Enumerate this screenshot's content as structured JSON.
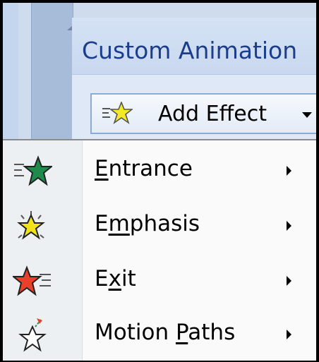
{
  "pane": {
    "title": "Custom Animation"
  },
  "add_effect": {
    "label": "Add Effect",
    "icon": "effect-star-icon"
  },
  "menu": {
    "items": [
      {
        "pre": "",
        "key": "E",
        "post": "ntrance",
        "icon": "entrance-star-icon",
        "color": "#1f8a4c"
      },
      {
        "pre": "E",
        "key": "m",
        "post": "phasis",
        "icon": "emphasis-star-icon",
        "color": "#f2e21a"
      },
      {
        "pre": "E",
        "key": "x",
        "post": "it",
        "icon": "exit-star-icon",
        "color": "#e8402a"
      },
      {
        "pre": "Motion ",
        "key": "P",
        "post": "aths",
        "icon": "motion-path-star-icon",
        "color": "#ffffff"
      }
    ]
  }
}
